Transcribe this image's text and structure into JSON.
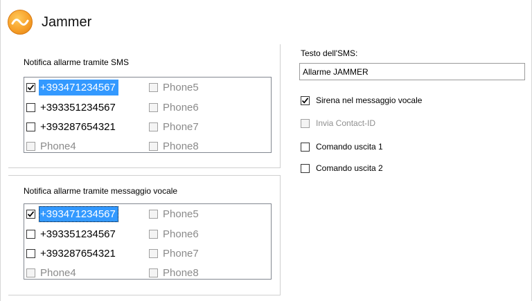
{
  "header": {
    "title": "Jammer"
  },
  "sms_group": {
    "label": "Notifica allarme tramite SMS",
    "items": [
      {
        "label": "+393471234567",
        "checked": true
      },
      {
        "label": "+393351234567",
        "checked": false
      },
      {
        "label": "+393287654321",
        "checked": false
      },
      {
        "label": "Phone4",
        "checked": false
      },
      {
        "label": "Phone5",
        "checked": false
      },
      {
        "label": "Phone6",
        "checked": false
      },
      {
        "label": "Phone7",
        "checked": false
      },
      {
        "label": "Phone8",
        "checked": false
      }
    ]
  },
  "voice_group": {
    "label": "Notifica allarme tramite messaggio vocale",
    "items": [
      {
        "label": "+393471234567",
        "checked": true
      },
      {
        "label": "+393351234567",
        "checked": false
      },
      {
        "label": "+393287654321",
        "checked": false
      },
      {
        "label": "Phone4",
        "checked": false
      },
      {
        "label": "Phone5",
        "checked": false
      },
      {
        "label": "Phone6",
        "checked": false
      },
      {
        "label": "Phone7",
        "checked": false
      },
      {
        "label": "Phone8",
        "checked": false
      }
    ]
  },
  "sms_text": {
    "label": "Testo dell'SMS:",
    "value": "Allarme JAMMER"
  },
  "options": [
    {
      "label": "Sirena nel messaggio vocale",
      "checked": true
    },
    {
      "label": "Invia Contact-ID",
      "checked": false
    },
    {
      "label": "Comando uscita 1",
      "checked": false
    },
    {
      "label": "Comando uscita 2",
      "checked": false
    }
  ],
  "colors": {
    "accent": "#f7a12a",
    "selection": "#3399ff"
  }
}
